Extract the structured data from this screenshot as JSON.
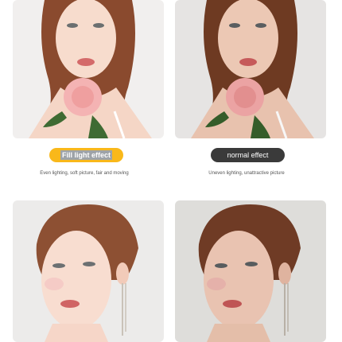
{
  "panels": {
    "left": {
      "label": "Fill light effect",
      "caption": "Even lighting, soft picture, fair and moving",
      "label_bg": "#f9b81a"
    },
    "right": {
      "label": "normal effect",
      "caption": "Uneven lighting, unattractive picture",
      "label_bg": "#3a3a3a"
    }
  }
}
